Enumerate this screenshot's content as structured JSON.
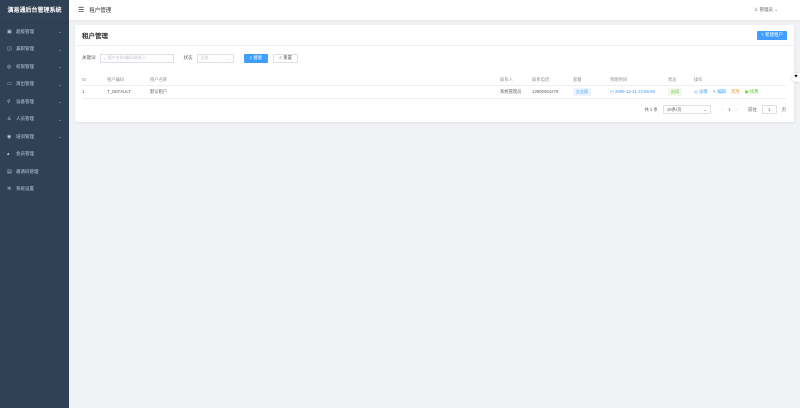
{
  "app_title": "演易通后台管理系统",
  "sidebar": {
    "items": [
      {
        "label": "超级管理",
        "icon": "▣",
        "expandable": true
      },
      {
        "label": "兼职管理",
        "icon": "◫",
        "expandable": true
      },
      {
        "label": "权限管理",
        "icon": "◎",
        "expandable": true
      },
      {
        "label": "演出管理",
        "icon": "▭",
        "expandable": true
      },
      {
        "label": "设备管理",
        "icon": "⚲",
        "expandable": true
      },
      {
        "label": "人员管理",
        "icon": "♙",
        "expandable": true
      },
      {
        "label": "培训管理",
        "icon": "◉",
        "expandable": true
      },
      {
        "label": "会员管理",
        "icon": "▴",
        "expandable": false
      },
      {
        "label": "邀请码管理",
        "icon": "▤",
        "expandable": false
      },
      {
        "label": "系统设置",
        "icon": "✲",
        "expandable": false
      }
    ]
  },
  "header": {
    "breadcrumb": "租户管理",
    "user": "管理员"
  },
  "card": {
    "title": "租户管理",
    "new_button": "+ 新建租户"
  },
  "filters": {
    "keyword_label": "关键词",
    "keyword_placeholder": "租户名称/编码/联系人",
    "status_label": "状态",
    "status_value": "全部",
    "search_button": "搜索",
    "reset_button": "重置"
  },
  "table": {
    "columns": [
      "ID",
      "租户编码",
      "租户名称",
      "联系人",
      "联系电话",
      "套餐",
      "到期时间",
      "状态",
      "操作"
    ],
    "rows": [
      {
        "id": "1",
        "code": "T_DEFAULT",
        "name": "默认租户",
        "contact": "系统管理员",
        "phone": "13900064279",
        "plan": "企业版",
        "expire": "2099-12-31 23:59:59",
        "status": "启用",
        "actions": [
          "详情",
          "编辑",
          "禁用",
          "续费"
        ]
      }
    ]
  },
  "pagination": {
    "total": "共 1 条",
    "page_size": "10条/页",
    "current": "1",
    "goto_label": "前往",
    "goto_value": "1",
    "page_suffix": "页"
  },
  "colors": {
    "primary": "#409eff",
    "sidebar": "#304156",
    "success": "#67c23a",
    "warning": "#e6a23c"
  }
}
